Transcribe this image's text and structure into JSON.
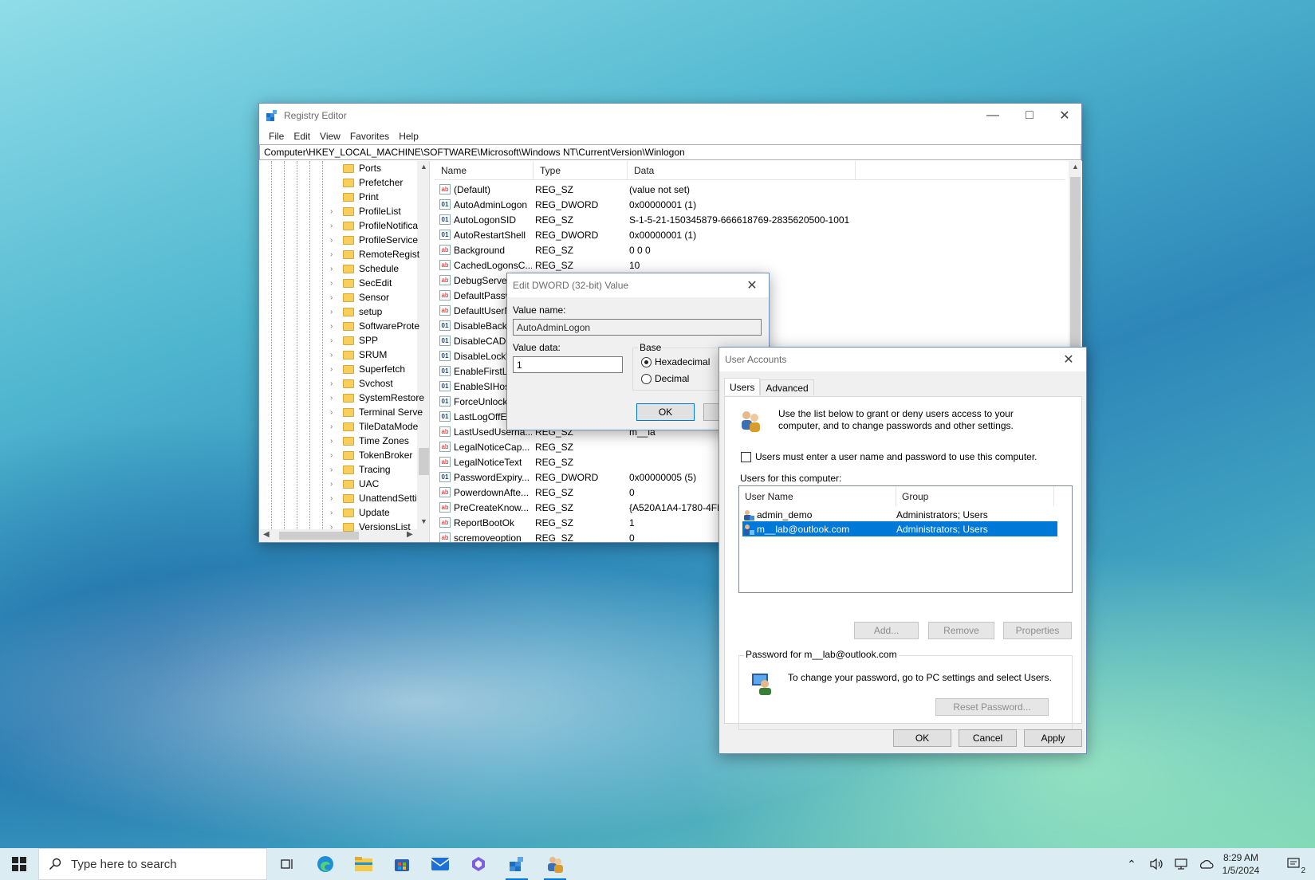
{
  "regedit": {
    "title": "Registry Editor",
    "menu": [
      "File",
      "Edit",
      "View",
      "Favorites",
      "Help"
    ],
    "address": "Computer\\HKEY_LOCAL_MACHINE\\SOFTWARE\\Microsoft\\Windows NT\\CurrentVersion\\Winlogon",
    "tree": [
      "Ports",
      "Prefetcher",
      "Print",
      "ProfileList",
      "ProfileNotifica",
      "ProfileService",
      "RemoteRegist",
      "Schedule",
      "SecEdit",
      "Sensor",
      "setup",
      "SoftwareProte",
      "SPP",
      "SRUM",
      "Superfetch",
      "Svchost",
      "SystemRestore",
      "Terminal Serve",
      "TileDataMode",
      "Time Zones",
      "TokenBroker",
      "Tracing",
      "UAC",
      "UnattendSetti",
      "Update",
      "VersionsList"
    ],
    "columns": {
      "name": "Name",
      "type": "Type",
      "data": "Data"
    },
    "values": [
      {
        "name": "(Default)",
        "type": "REG_SZ",
        "data": "(value not set)",
        "icon": "string-value-icon"
      },
      {
        "name": "AutoAdminLogon",
        "type": "REG_DWORD",
        "data": "0x00000001 (1)",
        "icon": "binary-value-icon"
      },
      {
        "name": "AutoLogonSID",
        "type": "REG_SZ",
        "data": "S-1-5-21-150345879-666618769-2835620500-1001",
        "icon": "binary-value-icon"
      },
      {
        "name": "AutoRestartShell",
        "type": "REG_DWORD",
        "data": "0x00000001 (1)",
        "icon": "binary-value-icon"
      },
      {
        "name": "Background",
        "type": "REG_SZ",
        "data": "0 0 0",
        "icon": "string-value-icon"
      },
      {
        "name": "CachedLogonsC...",
        "type": "REG_SZ",
        "data": "10",
        "icon": "string-value-icon"
      },
      {
        "name": "DebugServerC",
        "type": "",
        "data": "",
        "icon": "string-value-icon"
      },
      {
        "name": "DefaultPassw",
        "type": "",
        "data": "",
        "icon": "string-value-icon"
      },
      {
        "name": "DefaultUserN",
        "type": "",
        "data": "",
        "icon": "string-value-icon"
      },
      {
        "name": "DisableBackB",
        "type": "",
        "data": "",
        "icon": "binary-value-icon"
      },
      {
        "name": "DisableCAD",
        "type": "",
        "data": "",
        "icon": "binary-value-icon"
      },
      {
        "name": "DisableLockW",
        "type": "",
        "data": "",
        "icon": "binary-value-icon"
      },
      {
        "name": "EnableFirstLo",
        "type": "",
        "data": "",
        "icon": "binary-value-icon"
      },
      {
        "name": "EnableSIHost",
        "type": "",
        "data": "",
        "icon": "binary-value-icon"
      },
      {
        "name": "ForceUnlock",
        "type": "",
        "data": "",
        "icon": "binary-value-icon"
      },
      {
        "name": "LastLogOffEn",
        "type": "",
        "data": "",
        "icon": "binary-value-icon"
      },
      {
        "name": "LastUsedUserna...",
        "type": "REG_SZ",
        "data": "m__la",
        "icon": "string-value-icon"
      },
      {
        "name": "LegalNoticeCap...",
        "type": "REG_SZ",
        "data": "",
        "icon": "string-value-icon"
      },
      {
        "name": "LegalNoticeText",
        "type": "REG_SZ",
        "data": "",
        "icon": "string-value-icon"
      },
      {
        "name": "PasswordExpiry...",
        "type": "REG_DWORD",
        "data": "0x00000005 (5)",
        "icon": "binary-value-icon"
      },
      {
        "name": "PowerdownAfte...",
        "type": "REG_SZ",
        "data": "0",
        "icon": "string-value-icon"
      },
      {
        "name": "PreCreateKnow...",
        "type": "REG_SZ",
        "data": "{A520A1A4-1780-4FF",
        "icon": "string-value-icon"
      },
      {
        "name": "ReportBootOk",
        "type": "REG_SZ",
        "data": "1",
        "icon": "string-value-icon"
      },
      {
        "name": "scremoveoption",
        "type": "REG_SZ",
        "data": "0",
        "icon": "string-value-icon"
      }
    ]
  },
  "dword_dialog": {
    "title": "Edit DWORD (32-bit) Value",
    "value_name_label": "Value name:",
    "value_name": "AutoAdminLogon",
    "value_data_label": "Value data:",
    "value_data": "1",
    "base_label": "Base",
    "hex_label": "Hexadecimal",
    "dec_label": "Decimal",
    "base_selected": "Hexadecimal",
    "ok_label": "OK"
  },
  "user_accounts": {
    "title": "User Accounts",
    "tabs": [
      "Users",
      "Advanced"
    ],
    "intro": "Use the list below to grant or deny users access to your computer, and to change passwords and other settings.",
    "must_enter_label": "Users must enter a user name and password to use this computer.",
    "must_enter_checked": false,
    "users_label": "Users for this computer:",
    "columns": {
      "user": "User Name",
      "group": "Group"
    },
    "users": [
      {
        "name": "admin_demo",
        "group": "Administrators; Users"
      },
      {
        "name": "m__lab@outlook.com",
        "group": "Administrators; Users"
      }
    ],
    "selected_user": "m__lab@outlook.com",
    "add_label": "Add...",
    "remove_label": "Remove",
    "properties_label": "Properties",
    "password_group_label": "Password for m__lab@outlook.com",
    "password_text": "To change your password, go to PC settings and select Users.",
    "reset_label": "Reset Password...",
    "ok_label": "OK",
    "cancel_label": "Cancel",
    "apply_label": "Apply"
  },
  "taskbar": {
    "search_placeholder": "Type here to search",
    "time": "8:29 AM",
    "date": "1/5/2024",
    "notification_count": "2",
    "accent": "#0078d7"
  }
}
